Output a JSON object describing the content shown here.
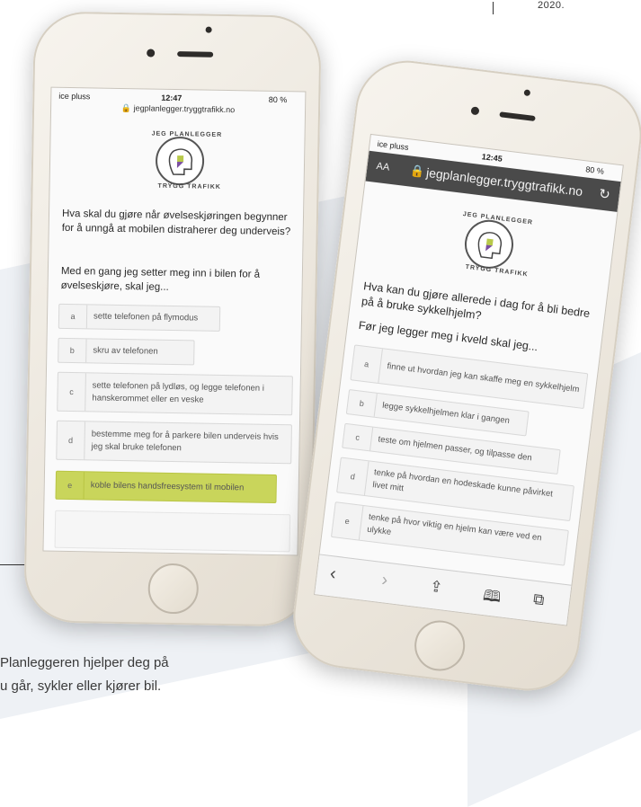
{
  "page": {
    "year": "2020.",
    "caption": [
      "Planleggeren hjelper deg på",
      "u går, sykler eller kjører bil."
    ]
  },
  "phone_left": {
    "status": {
      "carrier": "ice pluss",
      "time": "12:47",
      "battery": "80 %"
    },
    "url": "jegplanlegger.tryggtrafikk.no",
    "logo_top": "JEG PLANLEGGER",
    "logo_bottom": "TRYGG TRAFIKK",
    "question": "Hva skal du gjøre når øvelseskjøringen begynner for å unngå at mobilen distraherer deg underveis?",
    "prompt": "Med en gang jeg setter meg inn i bilen for å øvelseskjøre, skal jeg...",
    "options": [
      {
        "key": "a",
        "text": "sette telefonen på flymodus"
      },
      {
        "key": "b",
        "text": "skru av telefonen"
      },
      {
        "key": "c",
        "text": "sette telefonen på lydløs, og legge telefonen i hanskerommet eller en veske"
      },
      {
        "key": "d",
        "text": "bestemme meg for å parkere bilen underveis hvis jeg skal bruke telefonen"
      },
      {
        "key": "e",
        "text": "koble bilens handsfreesystem til mobilen",
        "selected": true
      }
    ]
  },
  "phone_right": {
    "status": {
      "carrier": "ice pluss",
      "time": "12:45",
      "battery": "80 %"
    },
    "text_size": "AA",
    "url": "jegplanlegger.tryggtrafikk.no",
    "logo_top": "JEG PLANLEGGER",
    "logo_bottom": "TRYGG TRAFIKK",
    "question": "Hva kan du gjøre allerede i dag for å bli bedre på å bruke sykkelhjelm?",
    "prompt": "Før jeg legger meg i kveld skal jeg...",
    "options": [
      {
        "key": "a",
        "text": "finne ut hvordan jeg kan skaffe meg en sykkelhjelm"
      },
      {
        "key": "b",
        "text": "legge sykkelhjelmen klar i gangen"
      },
      {
        "key": "c",
        "text": "teste om hjelmen passer, og tilpasse den"
      },
      {
        "key": "d",
        "text": "tenke på hvordan en hodeskade kunne påvirket livet mitt"
      },
      {
        "key": "e",
        "text": "tenke på hvor viktig en hjelm kan være ved en ulykke"
      }
    ],
    "toolbar_icons": [
      "back-icon",
      "forward-icon",
      "share-icon",
      "bookmarks-icon",
      "tabs-icon"
    ]
  },
  "colors": {
    "selected": "#c9d55b",
    "logo_purple": "#7a4ea0",
    "logo_green": "#b8c94a"
  }
}
